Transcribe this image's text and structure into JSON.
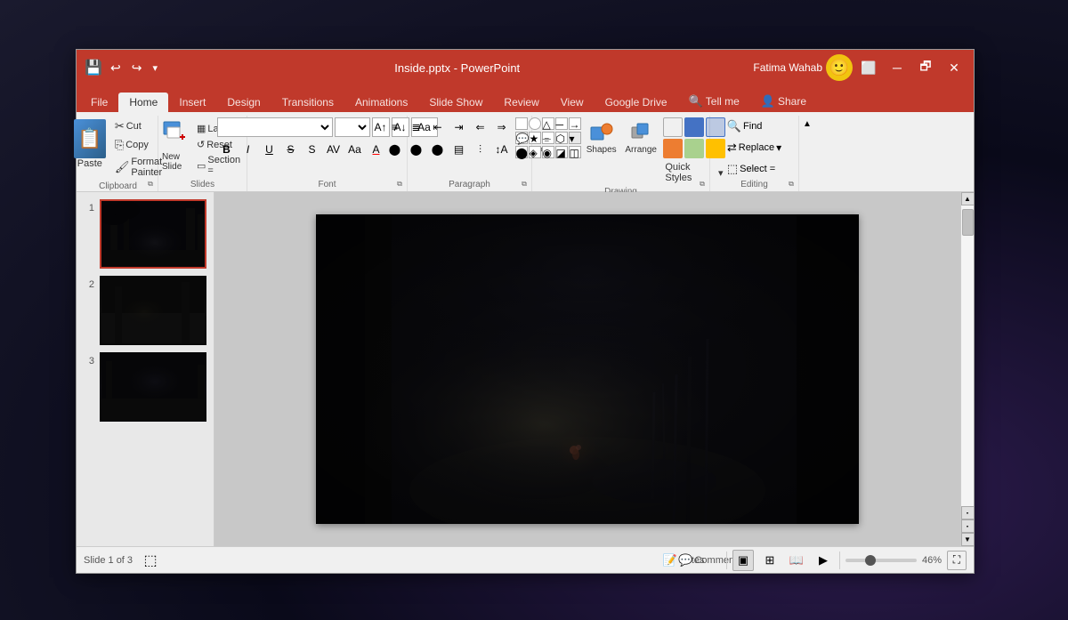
{
  "window": {
    "title": "Inside.pptx - PowerPoint",
    "username": "Fatima Wahab",
    "zoom": "46%",
    "slide_info": "Slide 1 of 3"
  },
  "titlebar": {
    "save_label": "💾",
    "undo_label": "↩",
    "redo_label": "↪",
    "pin_label": "📌",
    "minimize": "─",
    "restore": "🗗",
    "close": "✕",
    "account_icon": "🙂"
  },
  "tabs": [
    {
      "label": "File",
      "active": false
    },
    {
      "label": "Home",
      "active": true
    },
    {
      "label": "Insert",
      "active": false
    },
    {
      "label": "Design",
      "active": false
    },
    {
      "label": "Transitions",
      "active": false
    },
    {
      "label": "Animations",
      "active": false
    },
    {
      "label": "Slide Show",
      "active": false
    },
    {
      "label": "Review",
      "active": false
    },
    {
      "label": "View",
      "active": false
    },
    {
      "label": "Google Drive",
      "active": false
    },
    {
      "label": "Tell me",
      "active": false
    },
    {
      "label": "Share",
      "active": false
    }
  ],
  "ribbon": {
    "groups": [
      {
        "label": "Clipboard"
      },
      {
        "label": "Slides"
      },
      {
        "label": "Font"
      },
      {
        "label": "Paragraph"
      },
      {
        "label": "Drawing"
      },
      {
        "label": "Editing"
      }
    ],
    "clipboard": {
      "paste_label": "Paste",
      "cut_label": "Cut",
      "copy_label": "Copy",
      "format_painter": "Format Painter"
    },
    "slides": {
      "new_slide": "New Slide",
      "layout": "Layout",
      "reset": "Reset",
      "section": "Section ="
    },
    "font": {
      "font_name": "",
      "font_size": "",
      "bold": "B",
      "italic": "I",
      "underline": "U",
      "strikethrough": "S",
      "size_up": "A",
      "size_down": "A",
      "clear": "Aa",
      "font_color": "A"
    },
    "drawing": {
      "shapes_label": "Shapes",
      "arrange_label": "Arrange",
      "quick_styles_label": "Quick Styles",
      "select_label": "Select ="
    },
    "editing": {
      "find_label": "Find",
      "replace_label": "Replace",
      "select_label": "Select ="
    }
  },
  "slides": [
    {
      "number": "1",
      "selected": true
    },
    {
      "number": "2",
      "selected": false
    },
    {
      "number": "3",
      "selected": false
    }
  ],
  "statusbar": {
    "slide_info": "Slide 1 of 3",
    "notes_label": "Notes",
    "comments_label": "Comments",
    "zoom_level": "46%",
    "fit_label": "⛶"
  }
}
